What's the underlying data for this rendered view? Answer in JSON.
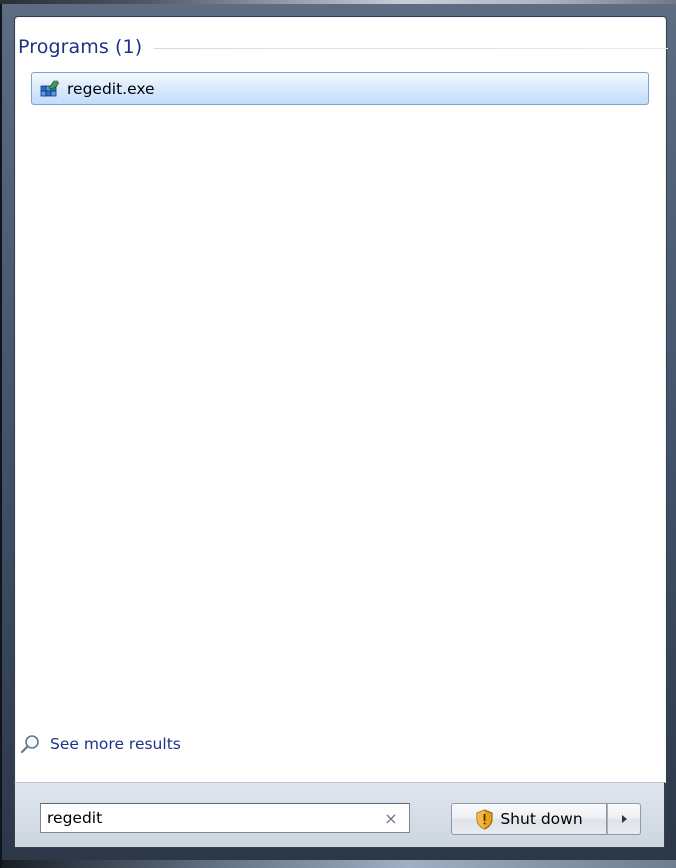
{
  "results": {
    "section_title": "Programs (1)",
    "items": [
      {
        "label": "regedit.exe",
        "icon": "registry-editor-icon"
      }
    ],
    "see_more_label": "See more results"
  },
  "search": {
    "value": "regedit",
    "clear_symbol": "×"
  },
  "power": {
    "shutdown_label": "Shut down",
    "options_icon": "triangle-right-icon"
  },
  "colors": {
    "link_blue": "#1e3287",
    "highlight_border": "#7da2ce",
    "highlight_fill": "#c1dcfc",
    "bar_fill": "#cdd6e0"
  }
}
